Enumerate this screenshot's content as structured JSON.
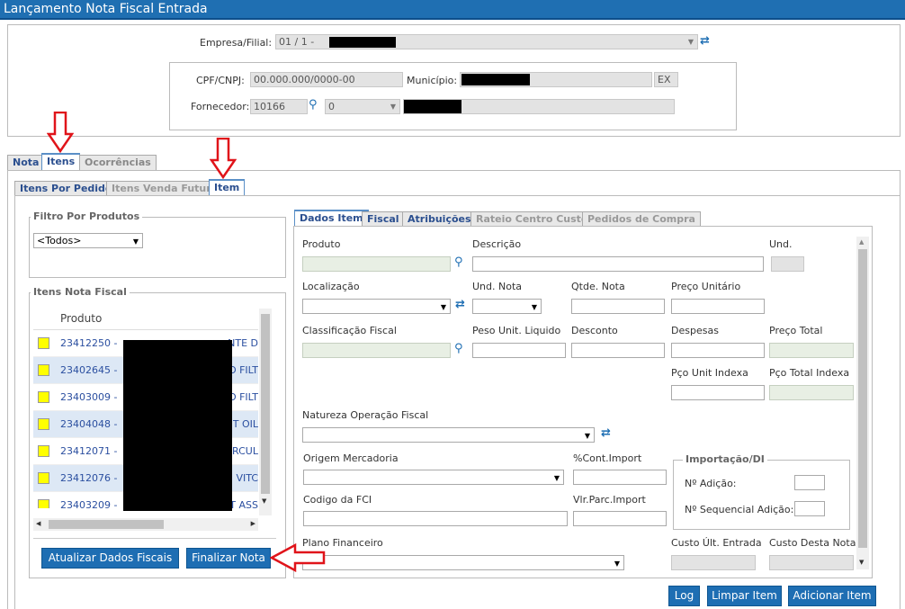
{
  "window": {
    "title": "Lançamento Nota Fiscal Entrada"
  },
  "header": {
    "empresa_label": "Empresa/Filial:",
    "empresa_value": "01 / 1 -",
    "cpf_label": "CPF/CNPJ:",
    "cpf_value": "00.000.000/0000-00",
    "municipio_label": "Município:",
    "uf_value": "EX",
    "fornecedor_label": "Fornecedor:",
    "fornecedor_code": "10166",
    "fornecedor_select": "0"
  },
  "main_tabs": [
    "Nota",
    "Itens",
    "Ocorrências"
  ],
  "sub_tabs": [
    "Itens Por Pedido",
    "Itens Venda Futura",
    "Item"
  ],
  "left": {
    "filtro_title": "Filtro Por Produtos",
    "filtro_value": "<Todos>",
    "itens_title": "Itens Nota Fiscal",
    "col_produto": "Produto",
    "rows": [
      {
        "code": "23412250 -",
        "tail": "NTE D"
      },
      {
        "code": "23402645 -",
        "tail": "O FILT"
      },
      {
        "code": "23403009 -",
        "tail": "O FILT"
      },
      {
        "code": "23404048 -",
        "tail": "T OIL"
      },
      {
        "code": "23412071 -",
        "tail": "RCUL"
      },
      {
        "code": "23412076 -",
        "tail": "VITC"
      },
      {
        "code": "23403209 -",
        "tail": "T ASS"
      }
    ],
    "btn_atualizar": "Atualizar Dados Fiscais",
    "btn_finalizar": "Finalizar Nota"
  },
  "item_tabs": [
    "Dados Item",
    "Fiscal",
    "Atribuições",
    "Rateio Centro Custo",
    "Pedidos de Compra"
  ],
  "form": {
    "produto": "Produto",
    "descricao": "Descrição",
    "und": "Und.",
    "localizacao": "Localização",
    "und_nota": "Und. Nota",
    "qtde_nota": "Qtde. Nota",
    "preco_unit": "Preço Unitário",
    "class_fiscal": "Classificação Fiscal",
    "peso_unit": "Peso Unit. Liquido",
    "desconto": "Desconto",
    "despesas": "Despesas",
    "preco_total": "Preço Total",
    "pco_unit_idx": "Pço Unit Indexa",
    "pco_total_idx": "Pço Total Indexa",
    "natureza": "Natureza Operação Fiscal",
    "origem": "Origem Mercadoria",
    "cont_import": "%Cont.Import",
    "importacao": "Importação/DI",
    "n_adicao": "Nº Adição:",
    "n_seq": "Nº Sequencial Adição:",
    "codigo_fci": "Codigo da FCI",
    "vlr_parc": "Vlr.Parc.Import",
    "plano": "Plano Financeiro",
    "custo_ult": "Custo Últ. Entrada",
    "custo_nota": "Custo Desta Nota"
  },
  "footer": {
    "log": "Log",
    "limpar": "Limpar Item",
    "adicionar": "Adicionar Item"
  },
  "colors": {
    "titlebar": "#1f6fb2",
    "button": "#1e6eb3",
    "arrow": "#e0141a",
    "highlight": "#ffff00"
  }
}
